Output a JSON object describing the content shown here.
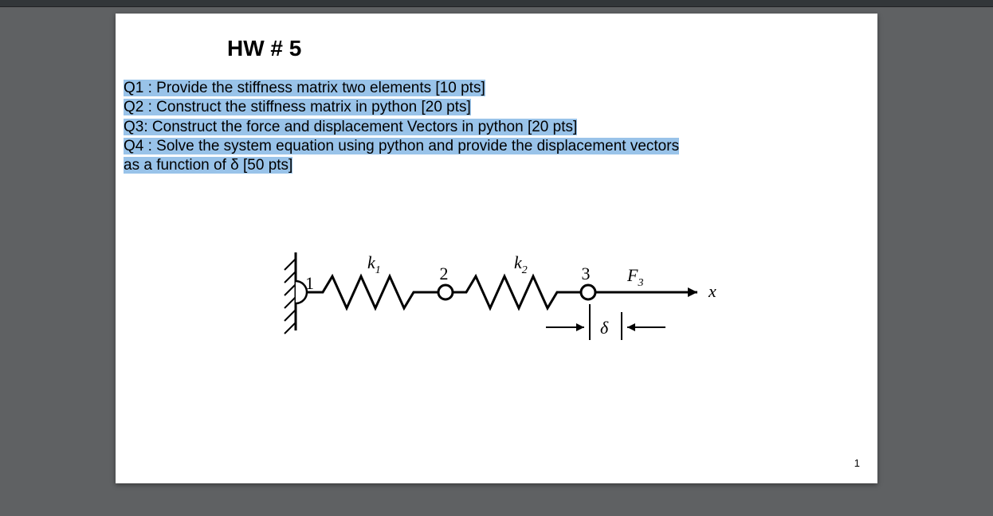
{
  "title": "HW # 5",
  "questions": {
    "q1": "Q1 : Provide the stiffness matrix two elements [10 pts]",
    "q2": "Q2 : Construct the stiffness matrix in python [20 pts]",
    "q3": "Q3:  Construct the force and displacement Vectors in python [20 pts]",
    "q4a": "Q4 : Solve the system equation using python and provide the displacement vectors ",
    "q4b": "as a function of  δ [50 pts]"
  },
  "figure": {
    "node1": "1",
    "node2": "2",
    "node3": "3",
    "k1": "k",
    "k1sub": "1",
    "k2": "k",
    "k2sub": "2",
    "F3": "F",
    "F3sub": "3",
    "delta": "δ",
    "x": "x"
  },
  "page_number": "1"
}
